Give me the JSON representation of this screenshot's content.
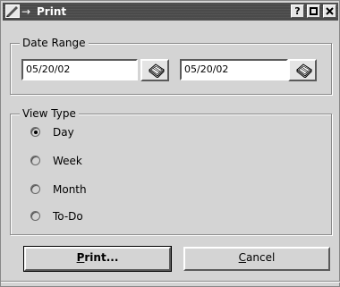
{
  "window": {
    "title": "Print",
    "title_prefix": "→",
    "controls": {
      "help": "?",
      "maximize": "□",
      "close": "×"
    }
  },
  "date_range": {
    "label": "Date Range",
    "start_value": "05/20/02",
    "end_value": "05/20/02",
    "calendar_icon": "calendar-icon"
  },
  "view_type": {
    "label": "View Type",
    "options": [
      {
        "label": "Day",
        "checked": true
      },
      {
        "label": "Week",
        "checked": false
      },
      {
        "label": "Month",
        "checked": false
      },
      {
        "label": "To-Do",
        "checked": false
      }
    ]
  },
  "buttons": {
    "print_label": "Print...",
    "print_mnemonic": "P",
    "print_rest": "rint...",
    "cancel_label": "Cancel",
    "cancel_mnemonic": "C",
    "cancel_rest": "ancel"
  }
}
